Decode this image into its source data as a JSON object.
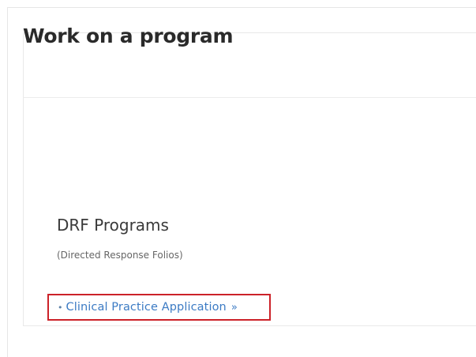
{
  "page": {
    "title": "Work on a program"
  },
  "section": {
    "heading": "DRF Programs",
    "subheading": "(Directed Response Folios)"
  },
  "programs": {
    "items": [
      {
        "bullet": "•",
        "label": "Clinical Practice Application",
        "chevron": "»",
        "chevron_icon": "double-chevron-right-icon",
        "highlighted": true
      }
    ]
  },
  "colors": {
    "link": "#3c7bc4",
    "highlight_border": "#cc2229",
    "title_text": "#2a2a2a"
  }
}
